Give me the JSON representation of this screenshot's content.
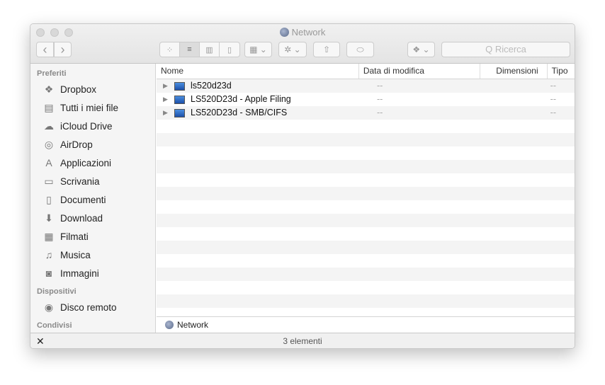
{
  "window": {
    "title": "Network"
  },
  "toolbar": {
    "back": "‹",
    "forward": "›",
    "view_icon": "⁘",
    "view_list": "≡",
    "view_columns": "▥",
    "view_coverflow": "▯",
    "arrange": "▦ ⌄",
    "action": "✲ ⌄",
    "share": "⇧",
    "tag": "⬭",
    "dropbox": "❖ ⌄",
    "search_placeholder": "Q Ricerca"
  },
  "sidebar": {
    "sections": [
      {
        "title": "Preferiti",
        "items": [
          {
            "label": "Dropbox",
            "icon": "❖"
          },
          {
            "label": "Tutti i miei file",
            "icon": "▤"
          },
          {
            "label": "iCloud Drive",
            "icon": "☁"
          },
          {
            "label": "AirDrop",
            "icon": "◎"
          },
          {
            "label": "Applicazioni",
            "icon": "A"
          },
          {
            "label": "Scrivania",
            "icon": "▭"
          },
          {
            "label": "Documenti",
            "icon": "▯"
          },
          {
            "label": "Download",
            "icon": "⬇"
          },
          {
            "label": "Filmati",
            "icon": "▦"
          },
          {
            "label": "Musica",
            "icon": "♫"
          },
          {
            "label": "Immagini",
            "icon": "◙"
          }
        ]
      },
      {
        "title": "Dispositivi",
        "items": [
          {
            "label": "Disco remoto",
            "icon": "◉"
          }
        ]
      },
      {
        "title": "Condivisi",
        "items": []
      }
    ]
  },
  "columns": {
    "name": "Nome",
    "date": "Data di modifica",
    "size": "Dimensioni",
    "type": "Tipo"
  },
  "rows": [
    {
      "name": "ls520d23d",
      "date": "--",
      "size": "--"
    },
    {
      "name": "LS520D23d - Apple Filing",
      "date": "--",
      "size": "--"
    },
    {
      "name": "LS520D23d - SMB/CIFS",
      "date": "--",
      "size": "--"
    }
  ],
  "pathbar": {
    "label": "Network"
  },
  "status": {
    "text": "3 elementi",
    "close": "✕"
  }
}
